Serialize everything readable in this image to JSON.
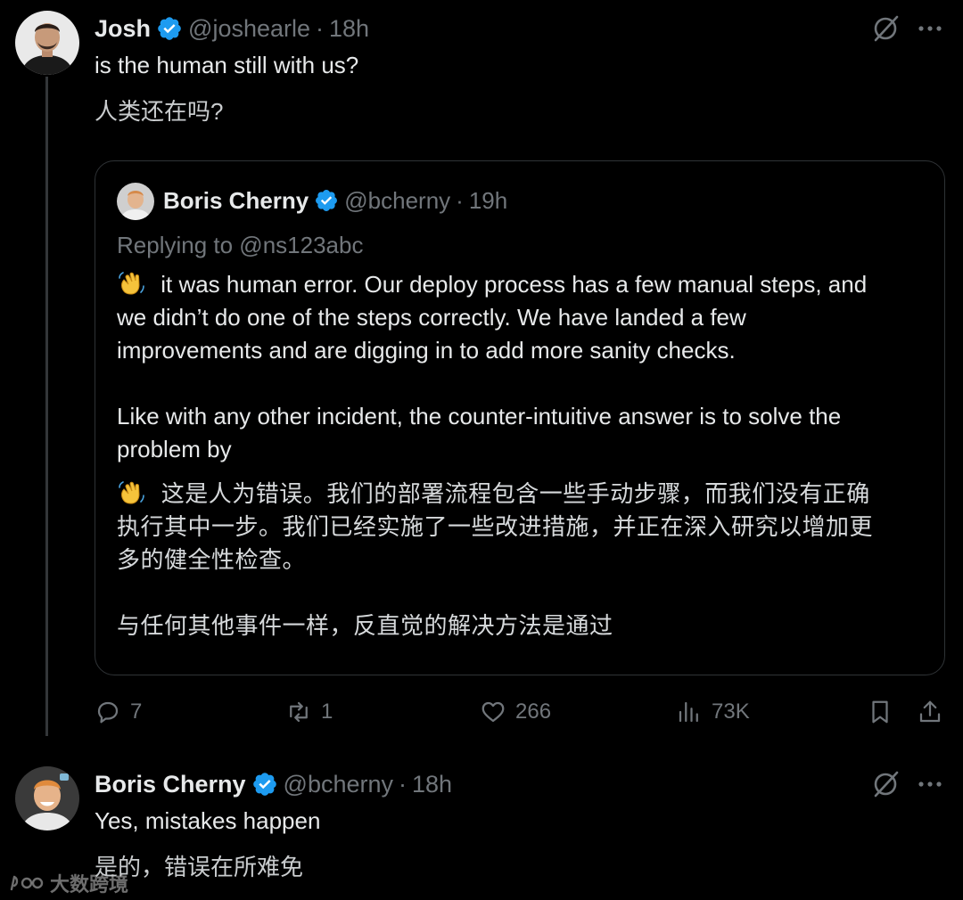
{
  "tweet": {
    "author_name": "Josh",
    "author_handle": "@joshearle",
    "separator": "·",
    "time": "18h",
    "text": "is the human still with us?",
    "translation": "人类还在吗?",
    "icons": [
      "grok-icon",
      "more-icon"
    ]
  },
  "quote": {
    "author_name": "Boris Cherny",
    "author_handle": "@bcherny",
    "separator": "·",
    "time": "19h",
    "replying_to": "Replying to @ns123abc",
    "emoji": "waving-hand",
    "paragraph1_line1": " it was human error. Our deploy process has a few manual steps, and",
    "paragraph1_line2": "we didn’t do one of the steps correctly. We have landed a few",
    "paragraph1_line3": "improvements and are digging in to add more sanity checks.",
    "paragraph2_line1": "Like with any other incident, the counter-intuitive answer is to solve the",
    "paragraph2_line2": "problem by",
    "cn_line1": " 这是人为错误。我们的部署流程包含一些手动步骤，而我们没有正确",
    "cn_line2": "执行其中一步。我们已经实施了一些改进措施，并正在深入研究以增加更",
    "cn_line3": "多的健全性检查。",
    "cn_line4": "与任何其他事件一样，反直觉的解决方法是通过"
  },
  "actions": {
    "replies": "7",
    "reposts": "1",
    "likes": "266",
    "views": "73K"
  },
  "reply": {
    "author_name": "Boris Cherny",
    "author_handle": "@bcherny",
    "separator": "·",
    "time": "18h",
    "text": "Yes, mistakes happen",
    "translation": "是的，错误在所难免"
  },
  "watermark": {
    "text": "大数跨境"
  },
  "colors": {
    "background": "#000000",
    "text": "#e7e9ea",
    "secondary": "#71767b",
    "verified": "#1d9bf0",
    "border": "#2f3336"
  }
}
